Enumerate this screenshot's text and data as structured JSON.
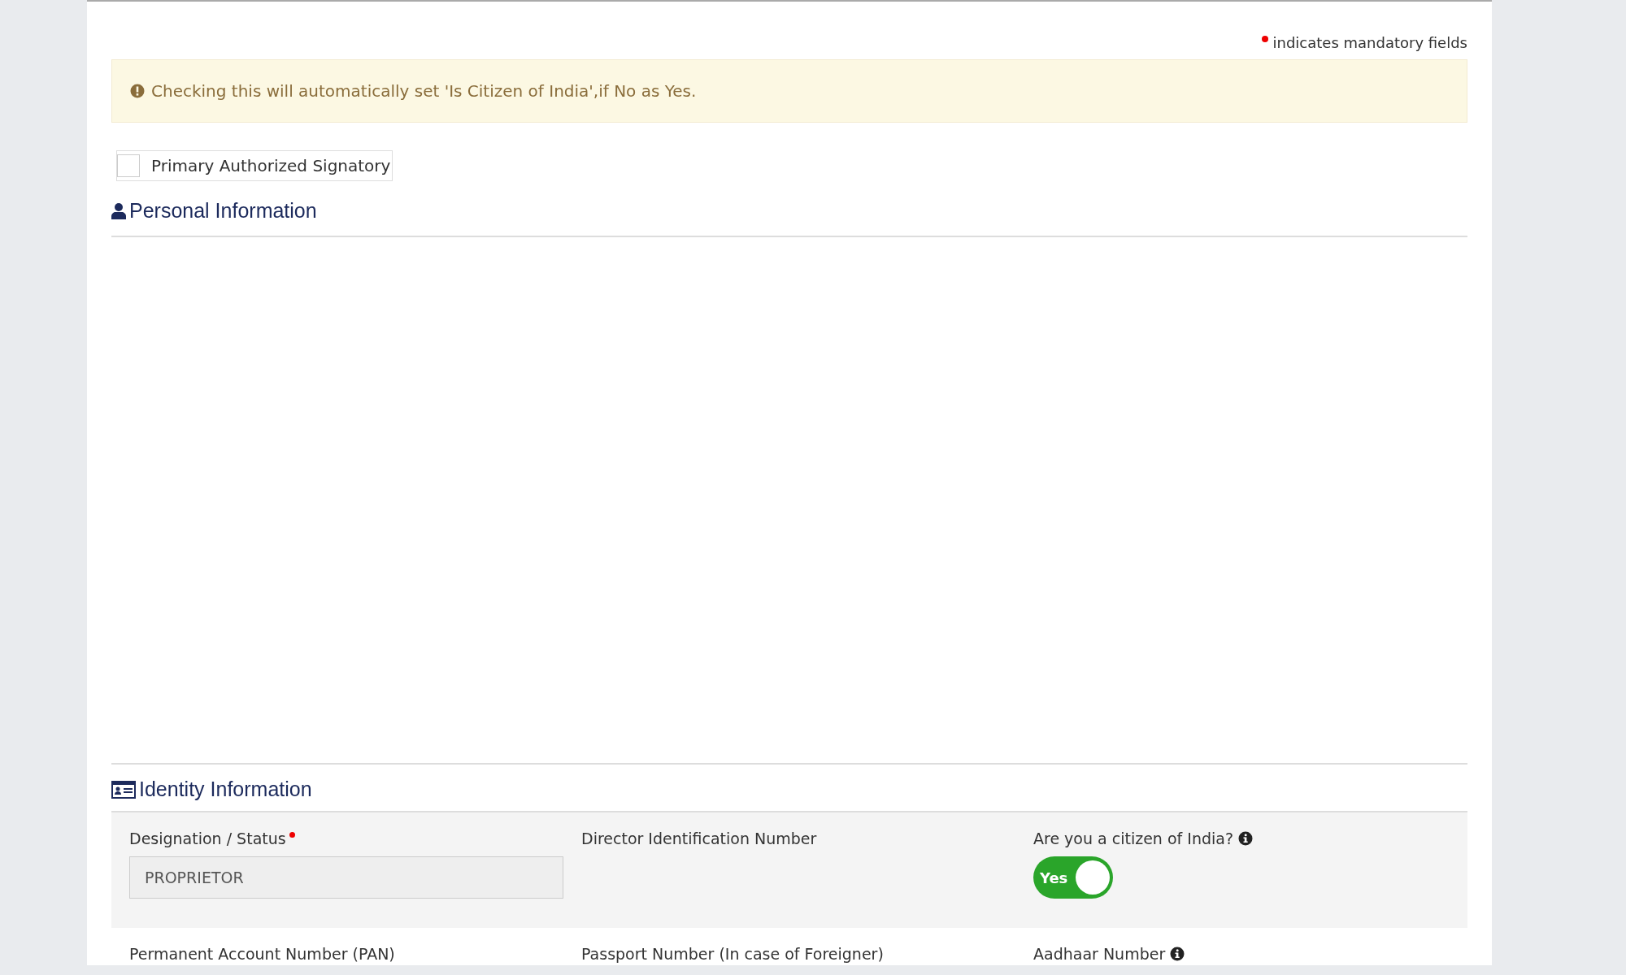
{
  "legend": {
    "text": "indicates mandatory fields"
  },
  "alert": {
    "text": "Checking this will automatically set 'Is Citizen of India',if No as Yes."
  },
  "signatory": {
    "label": "Primary Authorized Signatory",
    "checked": false
  },
  "personal_section": {
    "title": "Personal Information"
  },
  "identity_section": {
    "title": "Identity Information",
    "rows": [
      {
        "shaded": true,
        "fields": [
          {
            "kind": "input",
            "label": "Designation / Status",
            "required": true,
            "info": false,
            "value": "PROPRIETOR",
            "disabled": true
          },
          {
            "kind": "label",
            "label": "Director Identification Number",
            "required": false,
            "info": false
          },
          {
            "kind": "toggle",
            "label": "Are you a citizen of India?",
            "required": false,
            "info": true,
            "on": true,
            "toggle_text": "Yes"
          }
        ]
      },
      {
        "shaded": false,
        "fields": [
          {
            "kind": "label",
            "label": "Permanent Account Number (PAN)",
            "required": false,
            "info": false
          },
          {
            "kind": "label",
            "label": "Passport Number (In case of Foreigner)",
            "required": false,
            "info": false
          },
          {
            "kind": "label",
            "label": "Aadhaar Number",
            "required": false,
            "info": true
          }
        ]
      }
    ]
  }
}
